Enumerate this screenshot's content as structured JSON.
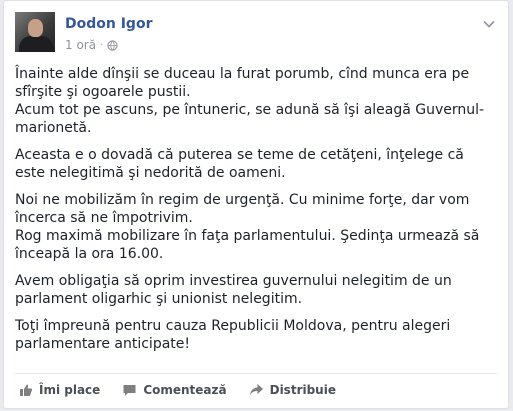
{
  "post": {
    "author": "Dodon Igor",
    "time": "1 oră",
    "separator": "·",
    "privacy_icon": "globe-icon",
    "menu_icon": "chevron-down-icon",
    "paragraphs": [
      {
        "lines": [
          "Înainte alde dînşii se duceau la furat porumb, cînd munca era pe sfîrşite şi ogoarele pustii.",
          "Acum tot pe ascuns, pe întuneric, se adună să îşi aleagă Guvernul-marionetă."
        ]
      },
      {
        "lines": [
          "Aceasta e o dovadă că puterea se teme de cetăţeni, înţelege că este nelegitimă şi nedorită de oameni."
        ]
      },
      {
        "lines": [
          "Noi ne mobilizăm în regim de urgenţă. Cu minime forţe, dar vom încerca să ne împotrivim.",
          "Rog maximă mobilizare în faţa parlamentului. Şedinţa urmează să înceapă la ora 16.00."
        ]
      },
      {
        "lines": [
          "Avem obligaţia să oprim investirea guvernului nelegitim de un parlament oligarhic şi unionist nelegitim."
        ]
      },
      {
        "lines": [
          "Toţi împreună pentru cauza Republicii Moldova, pentru alegeri parlamentare anticipate!"
        ]
      }
    ]
  },
  "actions": {
    "like_label": "Îmi place",
    "like_icon": "thumbs-up-icon",
    "comment_label": "Comentează",
    "comment_icon": "comment-icon",
    "share_label": "Distribuie",
    "share_icon": "share-icon"
  },
  "colors": {
    "author": "#365899",
    "meta": "#90949c",
    "text": "#1d2129",
    "action": "#4b4f56",
    "background": "#e9ebee"
  }
}
